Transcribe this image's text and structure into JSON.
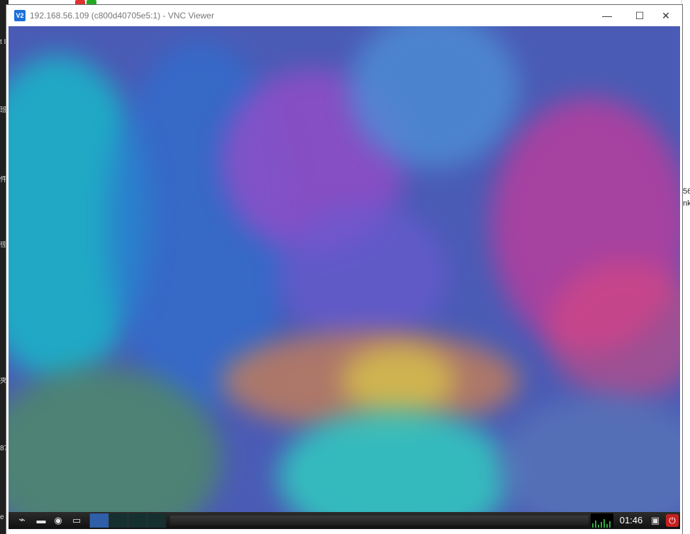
{
  "host": {
    "left_fragments": [
      "t I\\",
      "班",
      "件",
      "徑",
      "夾",
      "87",
      "e"
    ],
    "right_fragments": [
      "56",
      "nk"
    ]
  },
  "window": {
    "app_icon": "V2",
    "title": "192.168.56.109 (c800d40705e5:1) - VNC Viewer",
    "minimize_glyph": "—",
    "maximize_glyph": "☐",
    "close_glyph": "✕"
  },
  "remote_taskbar": {
    "clock": "01:46",
    "start_icon": "lxde-logo-icon",
    "icons": [
      "file-manager-icon",
      "browser-globe-icon",
      "show-desktop-icon"
    ],
    "desktops_count_label": "",
    "power_icon": "power-icon"
  },
  "colors": {
    "wallpaper_base": "#4a5bb5",
    "power_red": "#c62020",
    "active_desktop": "#2f5fa8"
  }
}
